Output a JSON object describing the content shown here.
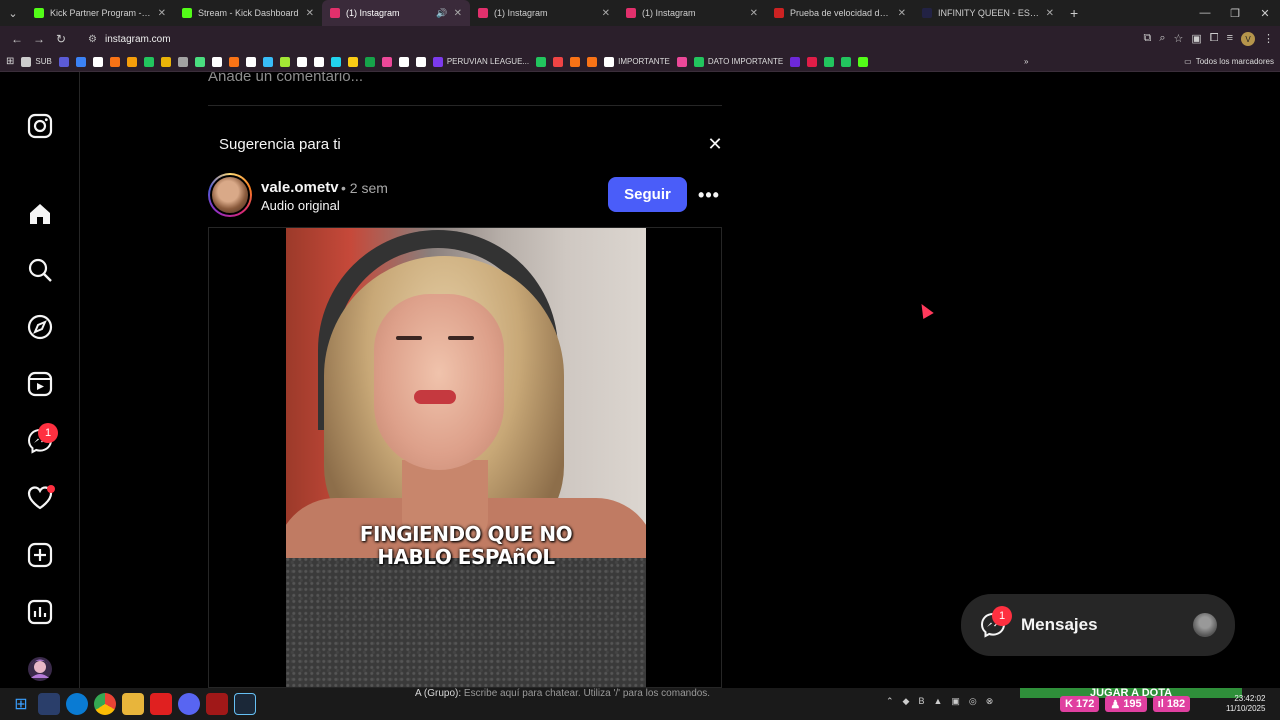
{
  "browser": {
    "tabs": [
      {
        "title": "Kick Partner Program - Kick Da",
        "favicon_color": "#53fc18",
        "active": false
      },
      {
        "title": "Stream - Kick Dashboard",
        "favicon_color": "#53fc18",
        "active": false
      },
      {
        "title": "(1) Instagram",
        "favicon_color": "#e1306c",
        "active": true
      },
      {
        "title": "(1) Instagram",
        "favicon_color": "#e1306c",
        "active": false
      },
      {
        "title": "(1) Instagram",
        "favicon_color": "#e1306c",
        "active": false
      },
      {
        "title": "Prueba de velocidad de Interne",
        "favicon_color": "#cc2222",
        "active": false
      },
      {
        "title": "INFINITY QUEEN - ESPORTS FE",
        "favicon_color": "#222244",
        "active": false
      }
    ],
    "url": "instagram.com",
    "profile_initial": "V",
    "bookmarks": [
      {
        "label": "SUB",
        "color": "#cccccc"
      },
      {
        "label": "",
        "color": "#5b5bd6"
      },
      {
        "label": "",
        "color": "#3b82f6"
      },
      {
        "label": "",
        "color": "#ffffff"
      },
      {
        "label": "",
        "color": "#f97316"
      },
      {
        "label": "",
        "color": "#f59e0b"
      },
      {
        "label": "",
        "color": "#22c55e"
      },
      {
        "label": "",
        "color": "#eab308"
      },
      {
        "label": "",
        "color": "#a3a3a3"
      },
      {
        "label": "",
        "color": "#4ade80"
      },
      {
        "label": "",
        "color": "#ffffff"
      },
      {
        "label": "",
        "color": "#f97316"
      },
      {
        "label": "",
        "color": "#ffffff"
      },
      {
        "label": "",
        "color": "#38bdf8"
      },
      {
        "label": "",
        "color": "#a3e635"
      },
      {
        "label": "",
        "color": "#ffffff"
      },
      {
        "label": "",
        "color": "#ffffff"
      },
      {
        "label": "",
        "color": "#22d3ee"
      },
      {
        "label": "",
        "color": "#facc15"
      },
      {
        "label": "",
        "color": "#16a34a"
      },
      {
        "label": "",
        "color": "#ec4899"
      },
      {
        "label": "",
        "color": "#ffffff"
      },
      {
        "label": "",
        "color": "#ffffff"
      },
      {
        "label": "PERUVIAN LEAGUE...",
        "color": "#7c3aed"
      },
      {
        "label": "",
        "color": "#22c55e"
      },
      {
        "label": "",
        "color": "#ef4444"
      },
      {
        "label": "",
        "color": "#f97316"
      },
      {
        "label": "",
        "color": "#f97316"
      },
      {
        "label": "IMPORTANTE",
        "color": "#ffffff"
      },
      {
        "label": "",
        "color": "#ec4899"
      },
      {
        "label": "DATO IMPORTANTE",
        "color": "#22c55e"
      },
      {
        "label": "",
        "color": "#6d28d9"
      },
      {
        "label": "",
        "color": "#e11d48"
      },
      {
        "label": "",
        "color": "#22c55e"
      },
      {
        "label": "",
        "color": "#22c55e"
      },
      {
        "label": "",
        "color": "#53fc18"
      }
    ],
    "all_bookmarks_label": "Todos los marcadores"
  },
  "sidebar": {
    "items": [
      {
        "name": "instagram-logo-icon",
        "badge": ""
      },
      {
        "name": "home-icon",
        "badge": ""
      },
      {
        "name": "search-icon",
        "badge": ""
      },
      {
        "name": "explore-icon",
        "badge": ""
      },
      {
        "name": "reels-icon",
        "badge": ""
      },
      {
        "name": "messenger-icon",
        "badge": "1"
      },
      {
        "name": "notifications-heart-icon",
        "badge": "dot"
      },
      {
        "name": "create-icon",
        "badge": ""
      },
      {
        "name": "dashboard-icon",
        "badge": ""
      },
      {
        "name": "profile-avatar",
        "badge": ""
      }
    ],
    "messenger_badge": "1"
  },
  "feed": {
    "comment_placeholder": "Añade un comentario...",
    "suggestion_title": "Sugerencia para ti",
    "post": {
      "username": "vale.ometv",
      "time": "• 2 sem",
      "audio": "Audio original",
      "follow_label": "Seguir",
      "more_label": "•••",
      "caption_line1": "FINGIENDO QUE NO",
      "caption_line2": "HABLO ESPAñOL"
    }
  },
  "messages": {
    "label": "Mensajes",
    "badge": "1"
  },
  "taskbar": {
    "chat_prefix": "A (Grupo):",
    "chat_hint": "Escribe aquí para chatear. Utiliza '/' para los comandos.",
    "banner": "JUGAR A DOTA",
    "stats": [
      {
        "label": "172",
        "icon": "kick-icon"
      },
      {
        "label": "195",
        "icon": "user-icon"
      },
      {
        "label": "182",
        "icon": "bars-icon"
      }
    ],
    "time": "23:42:02",
    "date": "11/10/2025"
  },
  "colors": {
    "accent": "#4a5df9",
    "badge": "#ff3040",
    "stats": "#e040a0"
  }
}
